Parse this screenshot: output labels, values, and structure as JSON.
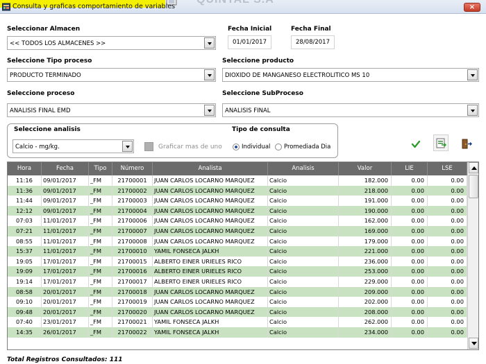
{
  "window": {
    "title": "Consulta y  graficas comportamiento de variables",
    "background_app_text": "QUINTAL S.A",
    "close_label": "×",
    "title_highlight_color": "#f5f000"
  },
  "form": {
    "almacen_label": "Seleccionar Almacen",
    "almacen_value": "<< TODOS LOS ALMACENES >>",
    "fecha_inicial_label": "Fecha Inicial",
    "fecha_inicial_value": "01/01/2017",
    "fecha_final_label": "Fecha Final",
    "fecha_final_value": "28/08/2017",
    "tipo_proceso_label": "Seleccione Tipo proceso",
    "tipo_proceso_value": "PRODUCTO TERMINADO",
    "producto_label": "Seleccione producto",
    "producto_value": "DIOXIDO DE MANGANESO ELECTROLITICO MS 10",
    "proceso_label": "Seleccione proceso",
    "proceso_value": "ANALISIS FINAL EMD",
    "subproceso_label": "Seleccione SubProceso",
    "subproceso_value": "ANALISIS FINAL",
    "analisis_label": "Seleccione analisis",
    "analisis_value": "Calcio - mg/kg.",
    "graficar_label": "Graficar mas de uno",
    "tipo_consulta_label": "Tipo de consulta",
    "radio_individual": "Individual",
    "radio_promediada": "Promediada Dia"
  },
  "toolbar": {
    "icons": [
      "checkmark-icon",
      "export-excel-icon",
      "exit-door-icon"
    ],
    "accent_green": "#2e9b2e"
  },
  "table": {
    "columns": [
      "Hora",
      "Fecha",
      "Tipo",
      "Número",
      "Analista",
      "Analisis",
      "Valor",
      "LIE",
      "LSE"
    ],
    "header_bg": "#6b6b6b",
    "alt_row_color": "#c9e2c1",
    "rows": [
      [
        "11:16",
        "09/01/2017",
        "_FM",
        "21700001",
        "JUAN CARLOS LOCARNO MARQUEZ",
        "Calcio",
        "182.000",
        "0.00",
        "0.00"
      ],
      [
        "11:36",
        "09/01/2017",
        "_FM",
        "21700002",
        "JUAN CARLOS LOCARNO MARQUEZ",
        "Calcio",
        "218.000",
        "0.00",
        "0.00"
      ],
      [
        "11:44",
        "09/01/2017",
        "_FM",
        "21700003",
        "JUAN CARLOS LOCARNO MARQUEZ",
        "Calcio",
        "191.000",
        "0.00",
        "0.00"
      ],
      [
        "12:12",
        "09/01/2017",
        "_FM",
        "21700004",
        "JUAN CARLOS LOCARNO MARQUEZ",
        "Calcio",
        "190.000",
        "0.00",
        "0.00"
      ],
      [
        "07:03",
        "11/01/2017",
        "_FM",
        "21700006",
        "JUAN CARLOS LOCARNO MARQUEZ",
        "Calcio",
        "162.000",
        "0.00",
        "0.00"
      ],
      [
        "07:21",
        "11/01/2017",
        "_FM",
        "21700007",
        "JUAN CARLOS LOCARNO MARQUEZ",
        "Calcio",
        "169.000",
        "0.00",
        "0.00"
      ],
      [
        "08:55",
        "11/01/2017",
        "_FM",
        "21700008",
        "JUAN CARLOS LOCARNO MARQUEZ",
        "Calcio",
        "179.000",
        "0.00",
        "0.00"
      ],
      [
        "15:37",
        "11/01/2017",
        "_FM",
        "21700010",
        "YAMIL FONSECA JALKH",
        "Calcio",
        "221.000",
        "0.00",
        "0.00"
      ],
      [
        "19:05",
        "17/01/2017",
        "_FM",
        "21700015",
        "ALBERTO EINER URIELES RICO",
        "Calcio",
        "236.000",
        "0.00",
        "0.00"
      ],
      [
        "19:09",
        "17/01/2017",
        "_FM",
        "21700016",
        "ALBERTO EINER URIELES RICO",
        "Calcio",
        "253.000",
        "0.00",
        "0.00"
      ],
      [
        "19:14",
        "17/01/2017",
        "_FM",
        "21700017",
        "ALBERTO EINER URIELES RICO",
        "Calcio",
        "229.000",
        "0.00",
        "0.00"
      ],
      [
        "08:58",
        "20/01/2017",
        "_FM",
        "21700018",
        "JUAN CARLOS LOCARNO MARQUEZ",
        "Calcio",
        "209.000",
        "0.00",
        "0.00"
      ],
      [
        "09:10",
        "20/01/2017",
        "_FM",
        "21700019",
        "JUAN CARLOS LOCARNO MARQUEZ",
        "Calcio",
        "202.000",
        "0.00",
        "0.00"
      ],
      [
        "09:48",
        "20/01/2017",
        "_FM",
        "21700020",
        "JUAN CARLOS LOCARNO MARQUEZ",
        "Calcio",
        "208.000",
        "0.00",
        "0.00"
      ],
      [
        "07:40",
        "23/01/2017",
        "_FM",
        "21700021",
        "YAMIL FONSECA JALKH",
        "Calcio",
        "262.000",
        "0.00",
        "0.00"
      ],
      [
        "14:35",
        "26/01/2017",
        "_FM",
        "21700022",
        "YAMIL FONSECA JALKH",
        "Calcio",
        "234.000",
        "0.00",
        "0.00"
      ]
    ]
  },
  "footer": {
    "total_label": "Total Registros Consultados: 111"
  }
}
